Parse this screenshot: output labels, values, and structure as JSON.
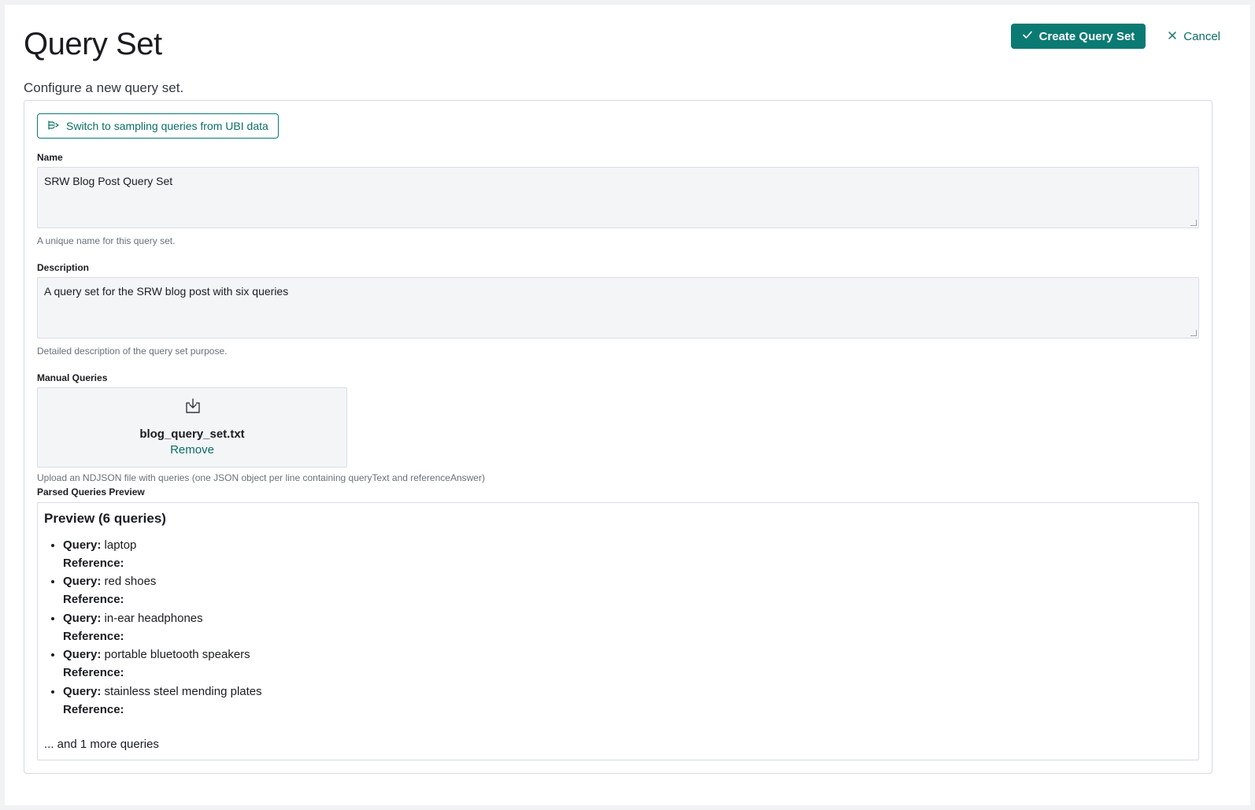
{
  "header": {
    "title": "Query Set",
    "create_label": "Create Query Set",
    "cancel_label": "Cancel",
    "subtitle": "Configure a new query set."
  },
  "form": {
    "switch_label": "Switch to sampling queries from UBI data",
    "name_label": "Name",
    "name_value": "SRW Blog Post Query Set",
    "name_help": "A unique name for this query set.",
    "description_label": "Description",
    "description_value": "A query set for the SRW blog post with six queries",
    "description_help": "Detailed description of the query set purpose.",
    "manual_label": "Manual Queries",
    "file_name": "blog_query_set.txt",
    "remove_label": "Remove",
    "upload_help": "Upload an NDJSON file with queries (one JSON object per line containing queryText and referenceAnswer)",
    "parsed_label": "Parsed Queries Preview"
  },
  "preview": {
    "title": "Preview (6 queries)",
    "query_key": "Query:",
    "reference_key": "Reference:",
    "items": [
      {
        "query": "laptop",
        "reference": ""
      },
      {
        "query": "red shoes",
        "reference": ""
      },
      {
        "query": "in-ear headphones",
        "reference": ""
      },
      {
        "query": "portable bluetooth speakers",
        "reference": ""
      },
      {
        "query": "stainless steel mending plates",
        "reference": ""
      }
    ],
    "more": "... and 1 more queries"
  },
  "colors": {
    "accent": "#0b7a72",
    "link": "#0b6e66",
    "field_bg": "#f4f5f7"
  },
  "icons": {
    "create": "check-icon",
    "cancel": "close-icon",
    "switch": "branch-icon",
    "upload": "download-tray-icon"
  }
}
